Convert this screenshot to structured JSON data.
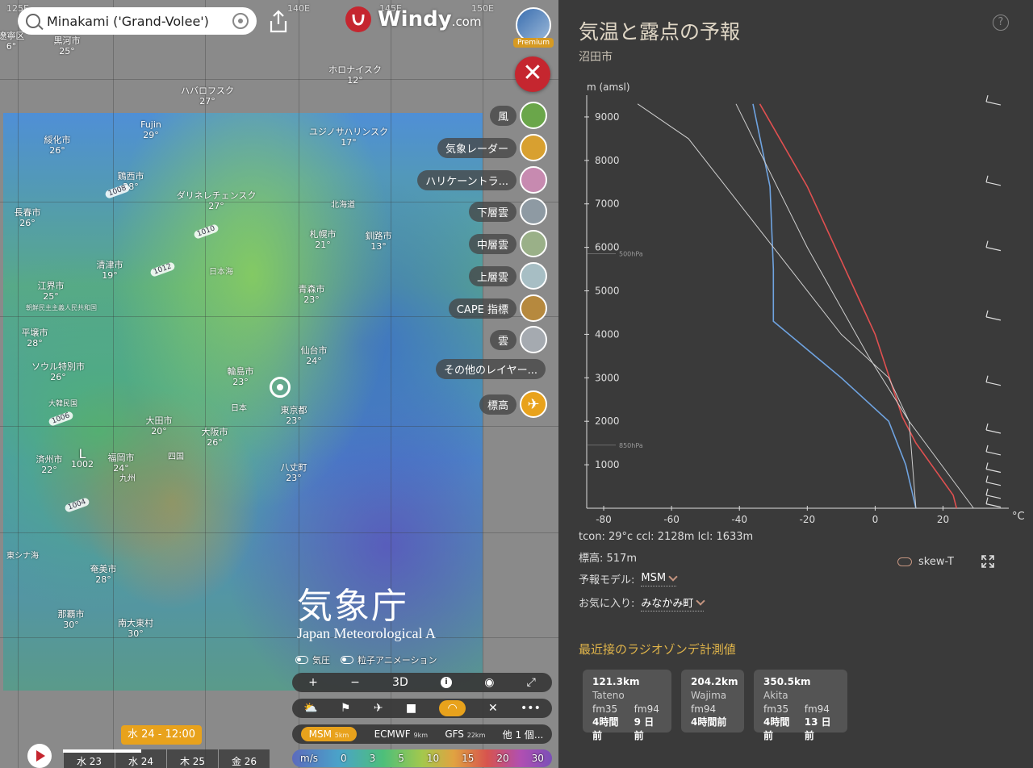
{
  "search": {
    "value": "Minakami ('Grand-Volee')"
  },
  "logo": {
    "brand": "Windy",
    "suffix": ".com"
  },
  "user": {
    "badge": "Premium"
  },
  "map": {
    "lon_labels": [
      "125E",
      "140E",
      "145E",
      "150E"
    ],
    "places": [
      {
        "name": "遼寧区",
        "temp": "6°"
      },
      {
        "name": "黒河市",
        "temp": "25°"
      },
      {
        "name": "ハバロフスク",
        "temp": "27°"
      },
      {
        "name": "Fujin",
        "temp": "29°"
      },
      {
        "name": "綏化市",
        "temp": "26°"
      },
      {
        "name": "鶏西市",
        "temp": "28°"
      },
      {
        "name": "ダリネレチェンスク",
        "temp": "27°"
      },
      {
        "name": "長春市",
        "temp": "26°"
      },
      {
        "name": "清津市",
        "temp": "19°"
      },
      {
        "name": "江界市",
        "temp": "25°"
      },
      {
        "name": "平壌市",
        "temp": "28°"
      },
      {
        "name": "ソウル特別市",
        "temp": "26°"
      },
      {
        "name": "大田市",
        "temp": "20°"
      },
      {
        "name": "福岡市",
        "temp": "24°"
      },
      {
        "name": "済州市",
        "temp": "22°"
      },
      {
        "name": "大阪市",
        "temp": "26°"
      },
      {
        "name": "東京都",
        "temp": "23°"
      },
      {
        "name": "輪島市",
        "temp": "23°"
      },
      {
        "name": "仙台市",
        "temp": "24°"
      },
      {
        "name": "青森市",
        "temp": "23°"
      },
      {
        "name": "札幌市",
        "temp": "21°"
      },
      {
        "name": "釧路市",
        "temp": "13°"
      },
      {
        "name": "ユジノサハリンスク",
        "temp": "17°"
      },
      {
        "name": "ホロナイスク",
        "temp": "12°"
      },
      {
        "name": "八丈町",
        "temp": "23°"
      },
      {
        "name": "奄美市",
        "temp": "28°"
      },
      {
        "name": "那覇市",
        "temp": "30°"
      },
      {
        "name": "南大東村",
        "temp": "30°"
      }
    ],
    "region_labels": [
      "日本海",
      "朝鮮民主主義人民共和国",
      "北海道",
      "日本",
      "四国",
      "九州",
      "東シナ海",
      "大韓民国"
    ],
    "isobars": [
      "1008",
      "1010",
      "1012",
      "1006",
      "1004"
    ],
    "low": {
      "letter": "L",
      "value": "1002"
    }
  },
  "layers": [
    {
      "label": "風",
      "color": "#6aa64a"
    },
    {
      "label": "気象レーダー",
      "color": "#d8a030"
    },
    {
      "label": "ハリケーントラ...",
      "color": "#c78ab0"
    },
    {
      "label": "下層雲",
      "color": "#8e9aa3"
    },
    {
      "label": "中層雲",
      "color": "#9ab088"
    },
    {
      "label": "上層雲",
      "color": "#a7bec4"
    },
    {
      "label": "CAPE 指標",
      "color": "#b6893e"
    },
    {
      "label": "雲",
      "color": "#a5aab0"
    }
  ],
  "layer_more": "その他のレイヤー...",
  "elevation_button": "標高",
  "watermark": {
    "jp": "気象庁",
    "en": "Japan Meteorological A"
  },
  "toggles": {
    "pressure": "気圧",
    "particles": "粒子アニメーション"
  },
  "map_toolbar": {
    "plus": "+",
    "minus": "−",
    "three_d": "3D",
    "info": "i",
    "hurricane": "◉",
    "fullscreen": "⤢"
  },
  "model_bar": [
    {
      "name": "MSM",
      "res": "5km",
      "active": true
    },
    {
      "name": "ECMWF",
      "res": "9km",
      "active": false
    },
    {
      "name": "GFS",
      "res": "22km",
      "active": false
    },
    {
      "name": "他 1 個...",
      "res": "",
      "active": false
    }
  ],
  "wind_legend": [
    "m/s",
    "0",
    "3",
    "5",
    "10",
    "15",
    "20",
    "30"
  ],
  "time": {
    "chip": "水 24 - 12:00",
    "days": [
      "水 23",
      "水 24",
      "木 25",
      "金 26"
    ],
    "progress": 0.38
  },
  "panel": {
    "title": "気温と露点の予報",
    "subtitle": "沼田市",
    "help": "?",
    "tcon_line": "tcon: 29°c ccl: 2128m lcl: 1633m",
    "elevation_line": "標高: 517m",
    "skewt_label": "skew-T",
    "model_label": "予報モデル:",
    "model_value": "MSM",
    "fav_label": "お気に入り:",
    "fav_value": "みなかみ町",
    "sonde_title": "最近接のラジオゾンデ計測値",
    "sondes": [
      {
        "dist": "121.3km",
        "name": "Tateno",
        "runs": [
          {
            "m": "fm35",
            "ago": "4時間前"
          },
          {
            "m": "fm94",
            "ago": "9 日前"
          }
        ]
      },
      {
        "dist": "204.2km",
        "name": "Wajima",
        "runs": [
          {
            "m": "fm94",
            "ago": "4時間前"
          }
        ]
      },
      {
        "dist": "350.5km",
        "name": "Akita",
        "runs": [
          {
            "m": "fm35",
            "ago": "4時間前"
          },
          {
            "m": "fm94",
            "ago": "13 日前"
          }
        ]
      }
    ]
  },
  "chart_data": {
    "type": "line",
    "ylabel": "m (amsl)",
    "xunit": "°C",
    "xlim": [
      -85,
      37
    ],
    "ylim": [
      0,
      9500
    ],
    "x_ticks": [
      -80,
      -60,
      -40,
      -20,
      0,
      20
    ],
    "y_ticks": [
      1000,
      2000,
      3000,
      4000,
      5000,
      6000,
      7000,
      8000,
      9000
    ],
    "pressure_marks": [
      {
        "label": "500hPa",
        "alt": 5850
      },
      {
        "label": "850hPa",
        "alt": 1450
      }
    ],
    "series": [
      {
        "color": "#e05050",
        "points": [
          [
            24,
            0
          ],
          [
            23,
            300
          ],
          [
            12,
            1500
          ],
          [
            8,
            2100
          ],
          [
            0,
            4000
          ],
          [
            -20,
            7400
          ],
          [
            -34,
            9300
          ]
        ]
      },
      {
        "color": "#6fa3e0",
        "points": [
          [
            12,
            0
          ],
          [
            9,
            1000
          ],
          [
            4,
            2000
          ],
          [
            -10,
            3000
          ],
          [
            -30,
            4300
          ],
          [
            -30,
            5500
          ],
          [
            -31,
            7400
          ],
          [
            -36,
            9300
          ]
        ]
      },
      {
        "color": "#cfcfcf",
        "points": [
          [
            12,
            0
          ],
          [
            10,
            2000
          ],
          [
            4,
            3000
          ],
          [
            -10,
            4000
          ],
          [
            -30,
            6000
          ],
          [
            -55,
            8500
          ],
          [
            -70,
            9300
          ]
        ]
      },
      {
        "color": "#cfcfcf",
        "points": [
          [
            29,
            0
          ],
          [
            10,
            2000
          ],
          [
            -2,
            3500
          ],
          [
            -20,
            6000
          ],
          [
            -41,
            9300
          ]
        ]
      }
    ],
    "wind_barb_alts": [
      9350,
      7500,
      6000,
      4400,
      2900,
      1800,
      1300,
      900,
      600,
      300,
      100
    ]
  }
}
